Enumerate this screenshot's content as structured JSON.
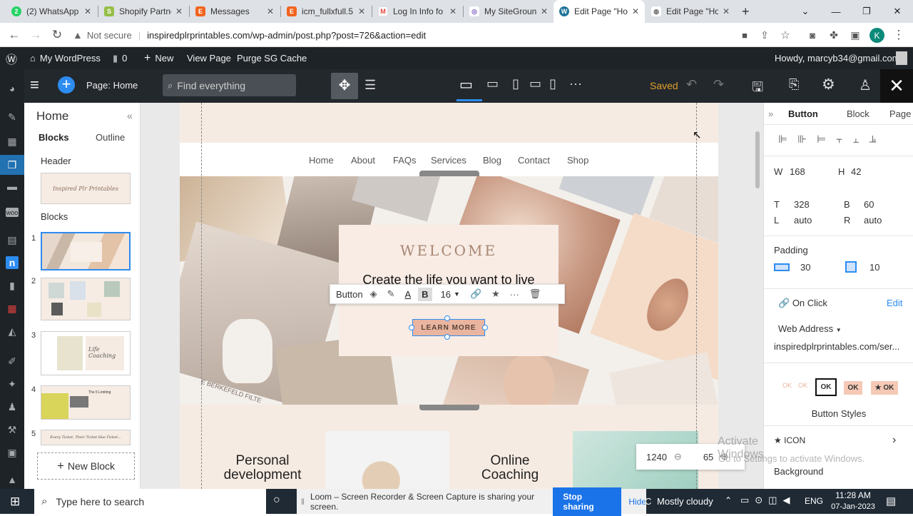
{
  "browser": {
    "tabs": [
      {
        "label": "(2) WhatsApp",
        "icon": "whatsapp-icon",
        "color": "#25d366",
        "glyph": "2"
      },
      {
        "label": "Shopify Partners",
        "icon": "shopify-icon",
        "color": "#95bf47",
        "glyph": "S"
      },
      {
        "label": "Messages",
        "icon": "etsy-icon",
        "color": "#f1641e",
        "glyph": "E"
      },
      {
        "label": "icm_fullxfull.5",
        "icon": "etsy-icon",
        "color": "#f1641e",
        "glyph": "E"
      },
      {
        "label": "Log In Info fo",
        "icon": "gmail-icon",
        "color": "#ea4335",
        "glyph": "M"
      },
      {
        "label": "My SiteGround",
        "icon": "siteground-icon",
        "color": "#7c5cbf",
        "glyph": "◎"
      },
      {
        "label": "Edit Page \"Ho",
        "icon": "wordpress-icon",
        "color": "#21759b",
        "glyph": "W"
      },
      {
        "label": "Edit Page \"Ho",
        "icon": "globe-icon",
        "color": "#666666",
        "glyph": "◍"
      }
    ],
    "active_tab": 6,
    "new_tab": "+",
    "security": "Not secure",
    "url": "inspiredplrprintables.com/wp-admin/post.php?post=726&action=edit",
    "profile_initial": "K"
  },
  "wpbar": {
    "site": "My WordPress",
    "comments": "0",
    "new": "New",
    "view": "View Page",
    "purge": "Purge SG Cache",
    "howdy": "Howdy, marcyb34@gmail.com"
  },
  "builder": {
    "page_label": "Page: Home",
    "search_placeholder": "Find everything",
    "saved": "Saved"
  },
  "left_panel": {
    "title": "Home",
    "tab_blocks": "Blocks",
    "tab_outline": "Outline",
    "header_label": "Header",
    "blocks_label": "Blocks",
    "header_thumb_text": "Inspired Plr Printables",
    "blocks": [
      "1",
      "2",
      "3",
      "4",
      "5"
    ],
    "block3_text": "Life Coaching",
    "block4_text": "The 5 Limiting",
    "block5_text": "Every Ticket, Their Ticket Has Ticket...",
    "new_block": "New Block"
  },
  "site": {
    "nav": [
      "Home",
      "About",
      "FAQs",
      "Services",
      "Blog",
      "Contact",
      "Shop"
    ],
    "welcome": "WELCOME",
    "tagline": "Create the life you want to live",
    "button": "LEARN MORE",
    "brand_stamp": "E BERKEFELD FILTE",
    "cards": [
      "Personal development",
      "Online Coaching"
    ]
  },
  "text_toolbar": {
    "label": "Button",
    "bold": "B",
    "size": "16"
  },
  "zoom": {
    "value": "1240",
    "second": "65"
  },
  "right_panel": {
    "tabs": [
      "Button",
      "Block",
      "Page"
    ],
    "w_label": "W",
    "w_value": "168",
    "h_label": "H",
    "h_value": "42",
    "t_label": "T",
    "t_value": "328",
    "b_label": "B",
    "b_value": "60",
    "l_label": "L",
    "l_value": "auto",
    "r_label": "R",
    "r_value": "auto",
    "padding_label": "Padding",
    "padding_h": "30",
    "padding_v": "10",
    "onclick": "On Click",
    "edit": "Edit",
    "web_address": "Web Address",
    "url": "inspiredplrprintables.com/ser...",
    "style_ok": "OK",
    "style_star": "★ OK",
    "button_styles": "Button Styles",
    "icon": "ICON",
    "background": "Background"
  },
  "watermark": {
    "line1": "Activate Windows",
    "line2": "Go to Settings to activate Windows."
  },
  "taskbar": {
    "search": "Type here to search",
    "loom": "Loom – Screen Recorder & Screen Capture is sharing your screen.",
    "stop": "Stop sharing",
    "hide": "Hide",
    "weather": "Mostly cloudy",
    "lang": "ENG",
    "time": "11:28 AM",
    "date": "07-Jan-2023",
    "weather_prefix": "C"
  },
  "colors": {
    "accent_blue": "#2d8cf0",
    "saved": "#e0a028",
    "peach": "#e9b5a0",
    "wp_dark": "#1d2327"
  }
}
